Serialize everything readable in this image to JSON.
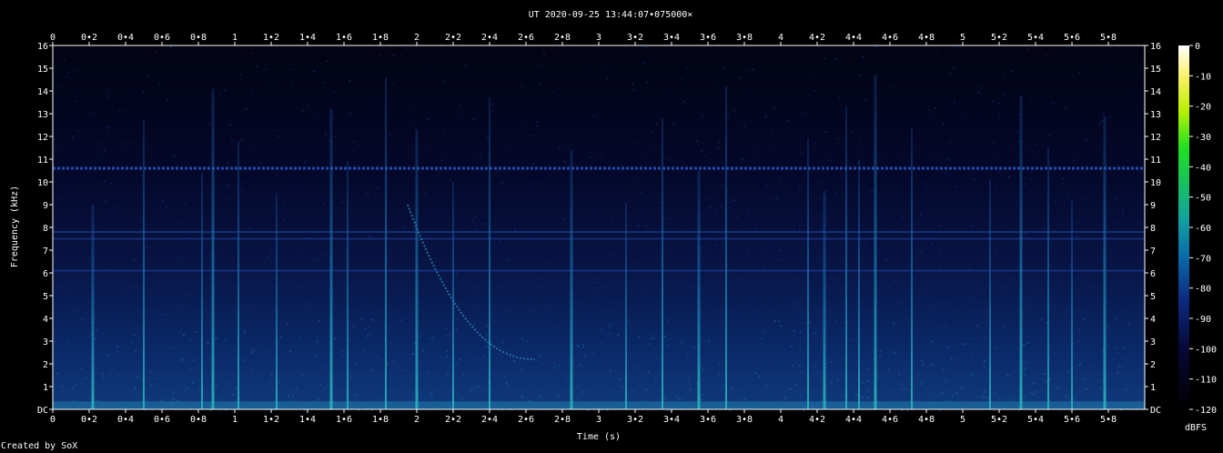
{
  "chart_data": {
    "type": "heatmap",
    "title": "UT 2020-09-25 13:44:07•075000×",
    "xlabel": "Time (s)",
    "ylabel": "Frequency (kHz)",
    "x_ticks": [
      "0",
      "0•2",
      "0•4",
      "0•6",
      "0•8",
      "1",
      "1•2",
      "1•4",
      "1•6",
      "1•8",
      "2",
      "2•2",
      "2•4",
      "2•6",
      "2•8",
      "3",
      "3•2",
      "3•4",
      "3•6",
      "3•8",
      "4",
      "4•2",
      "4•4",
      "4•6",
      "4•8",
      "5",
      "5•2",
      "5•4",
      "5•6",
      "5•8"
    ],
    "y_ticks": [
      "DC",
      "1",
      "2",
      "3",
      "4",
      "5",
      "6",
      "7",
      "8",
      "9",
      "10",
      "11",
      "12",
      "13",
      "14",
      "15",
      "16"
    ],
    "xlim": [
      0,
      5.98
    ],
    "ylim": [
      0,
      16
    ],
    "colorbar": {
      "label": "dBFS",
      "ticks": [
        "0",
        "-10",
        "-20",
        "-30",
        "-40",
        "-50",
        "-60",
        "-70",
        "-80",
        "-90",
        "-100",
        "-110",
        "-120"
      ],
      "range": [
        -120,
        0
      ]
    },
    "grid": false,
    "colors": {
      "background": "#000000",
      "noise": "#0a1a55",
      "signal": "#1fa0b4",
      "hot": "#39c9a8"
    },
    "features": {
      "carrier_khz": 10.6,
      "bands_khz": [
        6.1,
        7.5,
        7.8
      ],
      "impulses_s": [
        0.22,
        0.5,
        0.82,
        0.88,
        1.02,
        1.23,
        1.53,
        1.62,
        1.83,
        2.0,
        2.2,
        2.4,
        2.85,
        3.15,
        3.35,
        3.55,
        3.7,
        4.15,
        4.24,
        4.36,
        4.43,
        4.52,
        4.72,
        5.15,
        5.32,
        5.47,
        5.6,
        5.78
      ],
      "whistler": {
        "t_start": 1.95,
        "f_start_khz": 9.0,
        "t_end": 2.65,
        "f_end_khz": 2.2
      }
    }
  },
  "footer": {
    "credit": "Created by SoX"
  }
}
